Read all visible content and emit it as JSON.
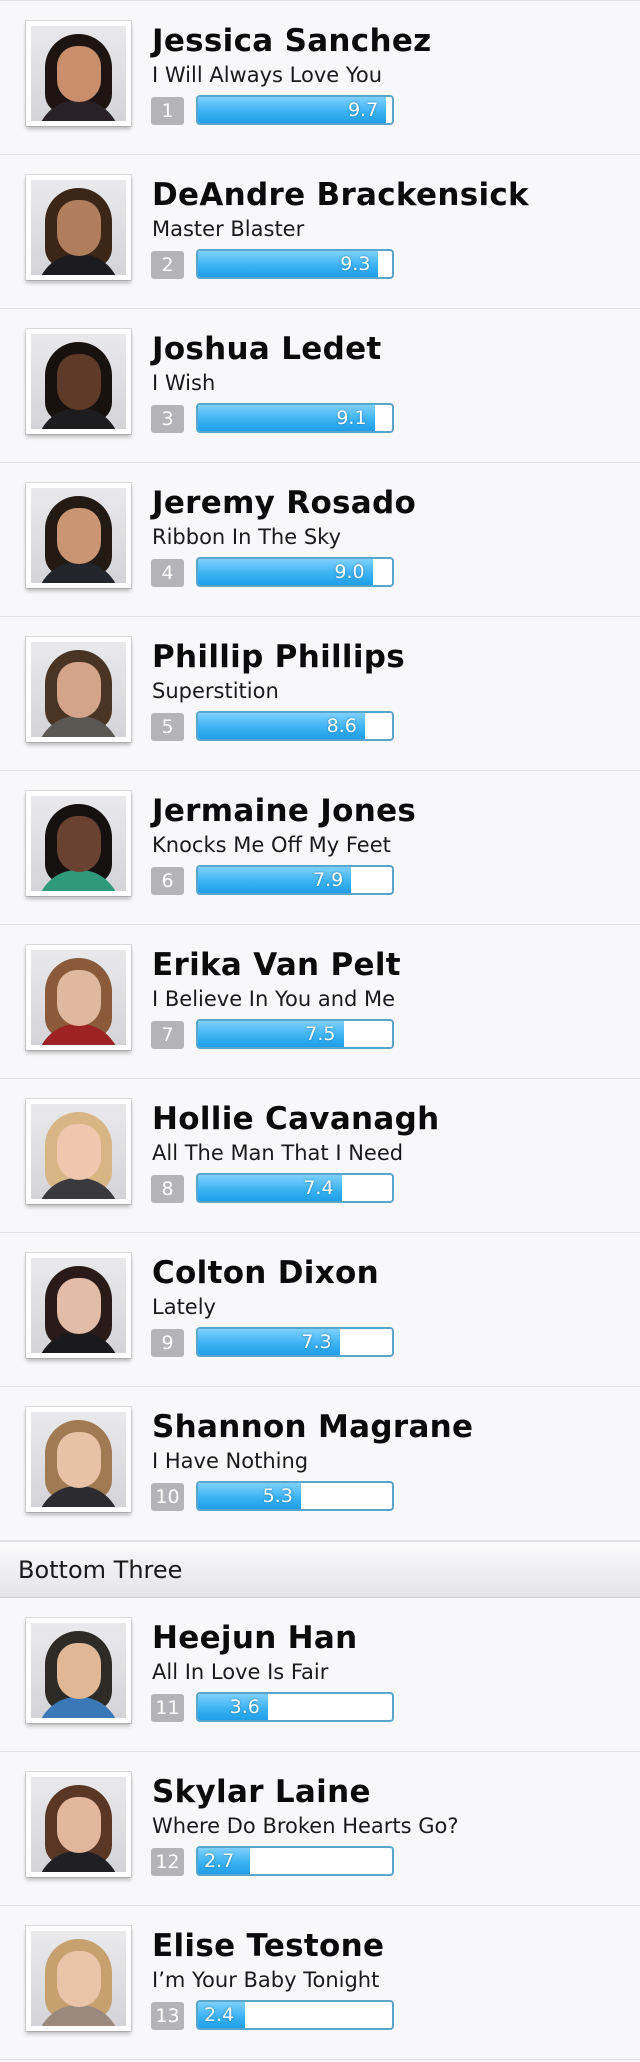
{
  "contestants": [
    {
      "name": "Jessica Sanchez",
      "song": "I Will Always Love You",
      "rank": "1",
      "score": "9.7",
      "score_value": 9.7,
      "hair": "#1e1512",
      "skin": "#c98e6c",
      "clothes": "#2a2226"
    },
    {
      "name": "DeAndre Brackensick",
      "song": "Master Blaster",
      "rank": "2",
      "score": "9.3",
      "score_value": 9.3,
      "hair": "#3b2618",
      "skin": "#b07e5c",
      "clothes": "#1c1c20"
    },
    {
      "name": "Joshua Ledet",
      "song": "I Wish",
      "rank": "3",
      "score": "9.1",
      "score_value": 9.1,
      "hair": "#18120f",
      "skin": "#5e3a28",
      "clothes": "#1d1d1f"
    },
    {
      "name": "Jeremy Rosado",
      "song": "Ribbon In The Sky",
      "rank": "4",
      "score": "9.0",
      "score_value": 9.0,
      "hair": "#241a14",
      "skin": "#c99573",
      "clothes": "#22252b"
    },
    {
      "name": "Phillip Phillips",
      "song": "Superstition",
      "rank": "5",
      "score": "8.6",
      "score_value": 8.6,
      "hair": "#4a3424",
      "skin": "#d3a48a",
      "clothes": "#5b5753"
    },
    {
      "name": "Jermaine Jones",
      "song": "Knocks Me Off My Feet",
      "rank": "6",
      "score": "7.9",
      "score_value": 7.9,
      "hair": "#151110",
      "skin": "#6a4231",
      "clothes": "#2f9a7a"
    },
    {
      "name": "Erika Van Pelt",
      "song": "I Believe In You and Me",
      "rank": "7",
      "score": "7.5",
      "score_value": 7.5,
      "hair": "#8a5a3a",
      "skin": "#e0b8a0",
      "clothes": "#9c2223"
    },
    {
      "name": "Hollie Cavanagh",
      "song": "All The Man That I Need",
      "rank": "8",
      "score": "7.4",
      "score_value": 7.4,
      "hair": "#d7b585",
      "skin": "#efc7ae",
      "clothes": "#3a3a3e"
    },
    {
      "name": "Colton Dixon",
      "song": "Lately",
      "rank": "9",
      "score": "7.3",
      "score_value": 7.3,
      "hair": "#2a1a18",
      "skin": "#e2bca6",
      "clothes": "#1a1a1d"
    },
    {
      "name": "Shannon Magrane",
      "song": "I Have Nothing",
      "rank": "10",
      "score": "5.3",
      "score_value": 5.3,
      "hair": "#a07a52",
      "skin": "#e8c2a6",
      "clothes": "#2b2b30"
    }
  ],
  "section": {
    "title": "Bottom Three"
  },
  "bottom_three": [
    {
      "name": "Heejun Han",
      "song": "All In Love Is Fair",
      "rank": "11",
      "score": "3.6",
      "score_value": 3.6,
      "hair": "#2e2a26",
      "skin": "#e0b896",
      "clothes": "#3a78b8"
    },
    {
      "name": "Skylar Laine",
      "song": "Where Do Broken Hearts Go?",
      "rank": "12",
      "score": "2.7",
      "score_value": 2.7,
      "hair": "#5a3624",
      "skin": "#e2b69c",
      "clothes": "#202024"
    },
    {
      "name": "Elise Testone",
      "song": "I’m Your Baby Tonight",
      "rank": "13",
      "score": "2.4",
      "score_value": 2.4,
      "hair": "#c7a070",
      "skin": "#eac4a8",
      "clothes": "#9a8a7e"
    }
  ],
  "scale_max": 10,
  "colors": {
    "bar_fill": "#3cb3f3",
    "bar_border": "#5aa5cc",
    "rank_badge": "#b4b4b8"
  }
}
